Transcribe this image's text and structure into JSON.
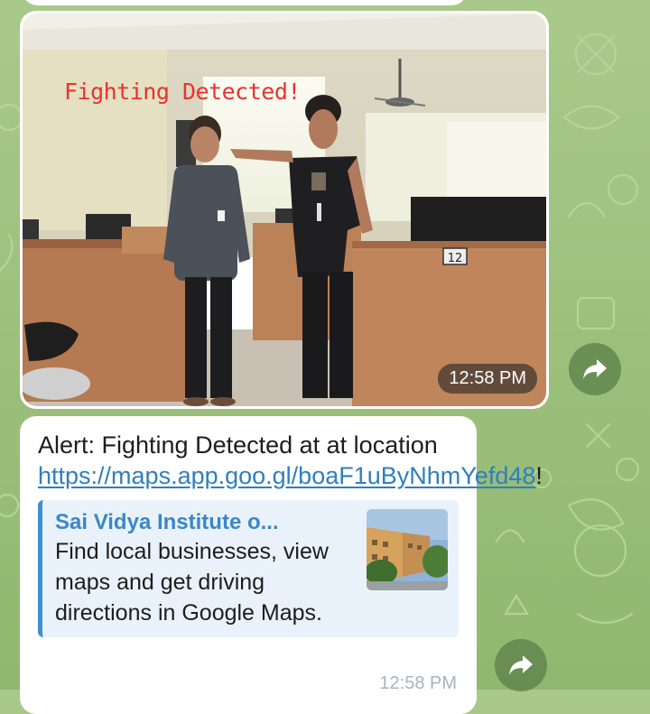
{
  "image_message": {
    "overlay_text": "Fighting Detected!",
    "time": "12:58 PM",
    "desk_tag": "12"
  },
  "text_message": {
    "text_before_link": "Alert: Fighting Detected at at location ",
    "link_text": "https://maps.app.goo.gl/boaF1uByNhmYefd48",
    "text_after_link": "!",
    "time": "12:58 PM",
    "link_preview": {
      "title": "Sai Vidya Institute o...",
      "description": "Find local businesses, view maps and get driving directions in Google Maps."
    }
  },
  "icons": {
    "forward": "forward-arrow-icon"
  },
  "colors": {
    "link": "#2f7fbf",
    "preview_accent": "#3f8fd6",
    "overlay_text": "#e8322f"
  }
}
